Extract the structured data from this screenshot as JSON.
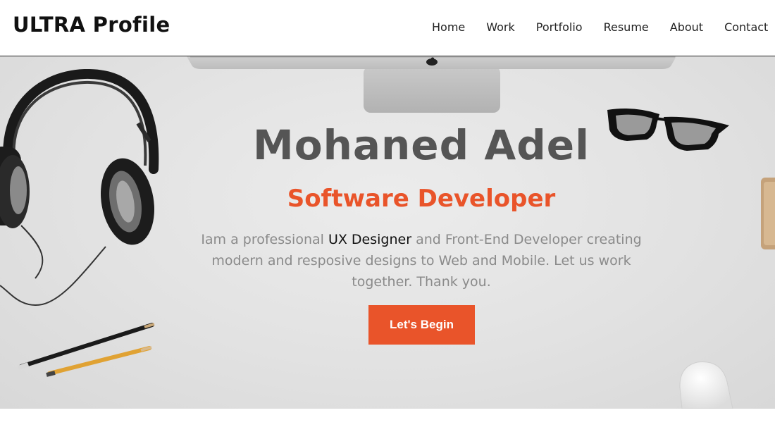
{
  "brand": "ULTRA Profile",
  "nav": [
    {
      "label": "Home"
    },
    {
      "label": "Work"
    },
    {
      "label": "Portfolio"
    },
    {
      "label": "Resume"
    },
    {
      "label": "About"
    },
    {
      "label": "Contact"
    }
  ],
  "hero": {
    "name": "Mohaned Adel",
    "role": "Software Developer",
    "desc_before": "Iam a professional ",
    "desc_highlight": "UX Designer",
    "desc_after": " and Front-End Developer creating modern and resposive designs to Web and Mobile. Let us work together. Thank you.",
    "button": "Let's Begin"
  },
  "colors": {
    "accent": "#e9542a",
    "name_text": "#555555",
    "desc_text": "#8a8a8a",
    "highlight_text": "#111111",
    "hero_background": "#e2e2e2"
  },
  "icons": [
    "headphones-image",
    "pencils-image",
    "imac-stand-image",
    "apple-logo-icon",
    "glasses-image",
    "mouse-image",
    "notepad-image"
  ]
}
